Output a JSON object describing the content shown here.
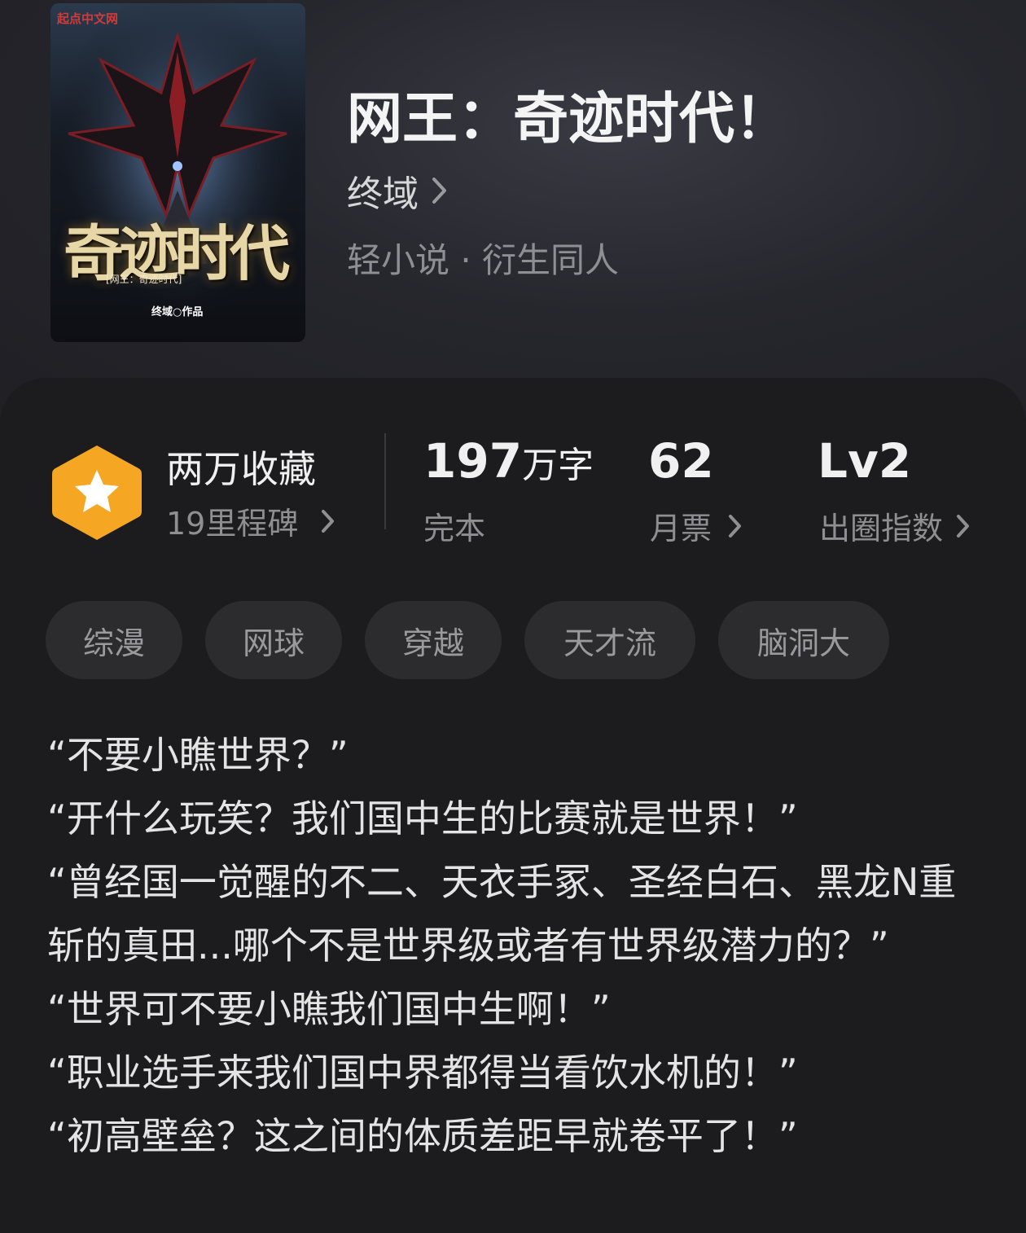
{
  "book": {
    "title": "网王：奇迹时代！",
    "author": "终域",
    "category": "轻小说 · 衍生同人"
  },
  "cover": {
    "site_label": "起点中文网",
    "big_title": "奇迹时代",
    "sub_title": "[网王：奇迹时代]",
    "author_line": "终域○作品"
  },
  "stats": {
    "favorites": {
      "title": "两万收藏",
      "subtitle": "19里程碑"
    },
    "words": {
      "value": "197",
      "unit": "万字",
      "subtitle": "完本"
    },
    "monthly_ticket": {
      "value": "62",
      "subtitle": "月票"
    },
    "influence": {
      "value": "Lv2",
      "subtitle": "出圈指数"
    }
  },
  "tags": [
    "综漫",
    "网球",
    "穿越",
    "天才流",
    "脑洞大"
  ],
  "description": [
    "“不要小瞧世界？”",
    "“开什么玩笑？我们国中生的比赛就是世界！”",
    "“曾经国一觉醒的不二、天衣手冢、圣经白石、黑龙N重斩的真田...哪个不是世界级或者有世界级潜力的？”",
    "“世界可不要小瞧我们国中生啊！”",
    "“职业选手来我们国中界都得当看饮水机的！”",
    "“初高壁垒？这之间的体质差距早就卷平了！”"
  ],
  "colors": {
    "background": "#1c1c1e",
    "badge_orange": "#f5a623",
    "tag_bg": "#2c2c2e",
    "muted_text": "#8e8e93"
  },
  "icons": [
    "star-hexagon-icon",
    "chevron-right-icon"
  ]
}
